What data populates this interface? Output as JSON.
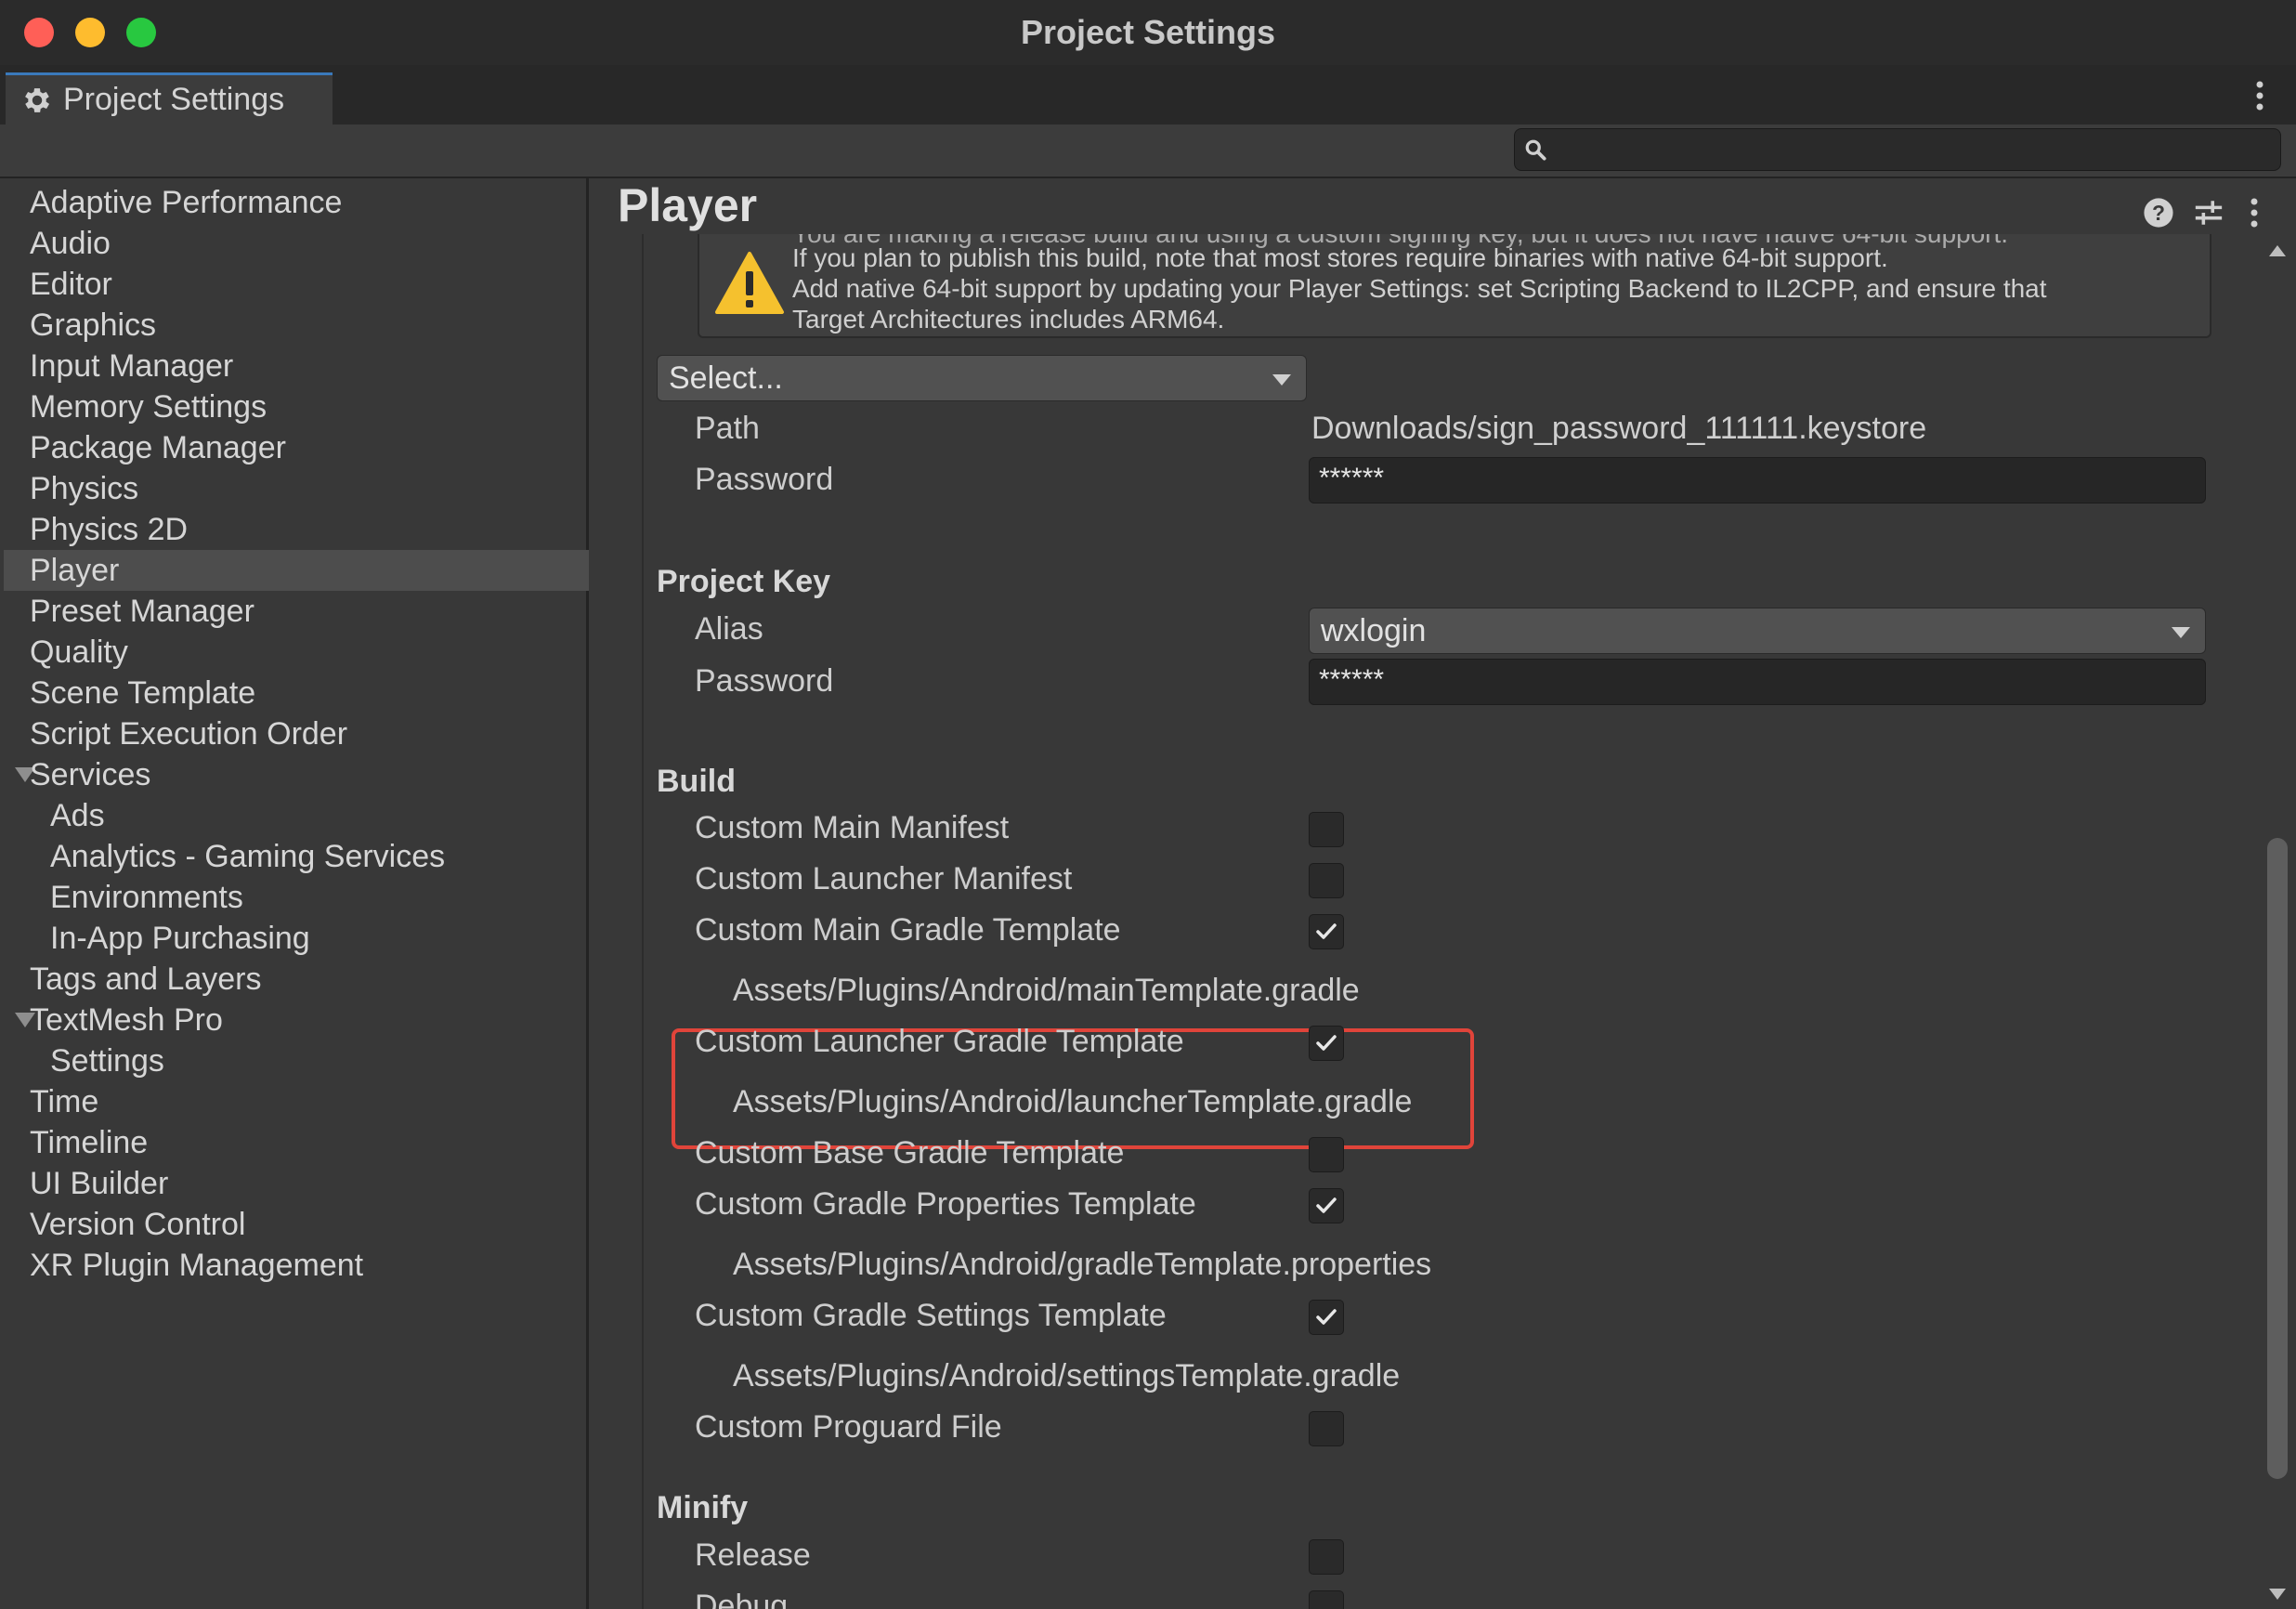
{
  "window": {
    "title": "Project Settings"
  },
  "tab": {
    "label": "Project Settings",
    "icon": "gear-icon"
  },
  "search": {
    "value": "",
    "placeholder": "",
    "icon": "search-icon"
  },
  "sidebar": {
    "items": [
      {
        "label": "Adaptive Performance"
      },
      {
        "label": "Audio"
      },
      {
        "label": "Editor"
      },
      {
        "label": "Graphics"
      },
      {
        "label": "Input Manager"
      },
      {
        "label": "Memory Settings"
      },
      {
        "label": "Package Manager"
      },
      {
        "label": "Physics"
      },
      {
        "label": "Physics 2D"
      },
      {
        "label": "Player",
        "selected": true
      },
      {
        "label": "Preset Manager"
      },
      {
        "label": "Quality"
      },
      {
        "label": "Scene Template"
      },
      {
        "label": "Script Execution Order"
      },
      {
        "label": "Services",
        "expanded": true
      },
      {
        "label": "Ads",
        "child": true
      },
      {
        "label": "Analytics - Gaming Services",
        "child": true
      },
      {
        "label": "Environments",
        "child": true
      },
      {
        "label": "In-App Purchasing",
        "child": true
      },
      {
        "label": "Tags and Layers"
      },
      {
        "label": "TextMesh Pro",
        "expanded": true
      },
      {
        "label": "Settings",
        "child": true
      },
      {
        "label": "Time"
      },
      {
        "label": "Timeline"
      },
      {
        "label": "UI Builder"
      },
      {
        "label": "Version Control"
      },
      {
        "label": "XR Plugin Management"
      }
    ]
  },
  "main": {
    "title": "Player",
    "header_icons": [
      "help-icon",
      "preset-sliders-icon",
      "kebab-menu-icon"
    ],
    "warning": {
      "icon": "warning-triangle-icon",
      "lines": [
        "You are making a release build and using a custom signing key, but it does not have native 64-bit support.",
        "If you plan to publish this build, note that most stores require binaries with native 64-bit support.",
        "Add native 64-bit support by updating your Player Settings: set Scripting Backend to IL2CPP, and ensure that",
        "Target Architectures includes ARM64."
      ]
    },
    "keystore_select": "Select...",
    "keystore": {
      "path_label": "Path",
      "path_value": "Downloads/sign_password_111111.keystore",
      "password_label": "Password",
      "password_value": "******"
    },
    "project_key": {
      "heading": "Project Key",
      "alias_label": "Alias",
      "alias_value": "wxlogin",
      "password_label": "Password",
      "password_value": "******"
    },
    "build": {
      "heading": "Build",
      "items": [
        {
          "label": "Custom Main Manifest",
          "checked": false
        },
        {
          "label": "Custom Launcher Manifest",
          "checked": false
        },
        {
          "label": "Custom Main Gradle Template",
          "checked": true,
          "path": "Assets/Plugins/Android/mainTemplate.gradle"
        },
        {
          "label": "Custom Launcher Gradle Template",
          "checked": true,
          "path": "Assets/Plugins/Android/launcherTemplate.gradle"
        },
        {
          "label": "Custom Base Gradle Template",
          "checked": false
        },
        {
          "label": "Custom Gradle Properties Template",
          "checked": true,
          "path": "Assets/Plugins/Android/gradleTemplate.properties"
        },
        {
          "label": "Custom Gradle Settings Template",
          "checked": true,
          "path": "Assets/Plugins/Android/settingsTemplate.gradle"
        },
        {
          "label": "Custom Proguard File",
          "checked": false
        }
      ]
    },
    "minify": {
      "heading": "Minify",
      "items": [
        {
          "label": "Release",
          "checked": false
        },
        {
          "label": "Debug",
          "checked": false
        }
      ]
    }
  },
  "colors": {
    "accent_tab": "#3a79bb",
    "highlight": "#e0443a",
    "warning": "#f5c12e"
  }
}
